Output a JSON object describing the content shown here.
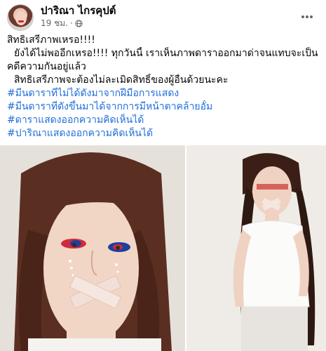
{
  "post": {
    "author": "ปาริณา ไกรคุปต์",
    "time": "19 ชม.",
    "more_icon": "more-horizontal-icon",
    "privacy_icon": "globe-icon",
    "text_lines": [
      "สิทธิเสรีภาพเหรอ!!!!",
      "ยังได้ไม่พออีกเหรอ!!!!  ทุกวันนี้ เราเห็นภาพดาราออกมาด่าจนแทบจะเป็น",
      "คดีความกันอยู่แล้ว",
      "สิทธิเสรีภาพจะต้องไม่ละเมิดสิทธิ์ของผู้อื่นด้วยนะคะ"
    ],
    "hashtags": [
      "#มีนดาราที่ไม่ได้ดังมาจากฝีมือการแสดง",
      "#มีนดาราที่ดังขึ้นมาได้จากการมีหน้าตาคล้ายอั้ม",
      "#ดาราแสดงออกความคิดเห็นได้",
      "#ปาริณาแสดงออกความคิดเห็นได้"
    ],
    "colors": {
      "hashtag": "#216fdb",
      "meta": "#65676b",
      "text": "#050505"
    }
  }
}
